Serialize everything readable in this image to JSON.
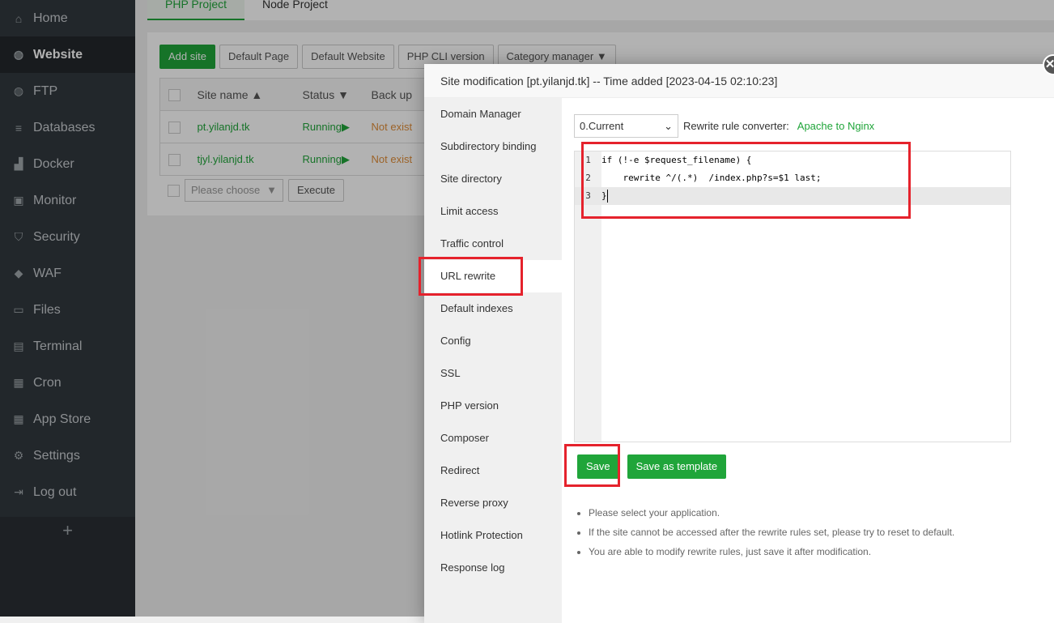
{
  "sidebar": {
    "items": [
      {
        "label": "Home",
        "icon": "home-icon"
      },
      {
        "label": "Website",
        "icon": "globe-icon",
        "active": true
      },
      {
        "label": "FTP",
        "icon": "ftp-icon"
      },
      {
        "label": "Databases",
        "icon": "database-icon"
      },
      {
        "label": "Docker",
        "icon": "docker-icon"
      },
      {
        "label": "Monitor",
        "icon": "monitor-icon"
      },
      {
        "label": "Security",
        "icon": "shield-icon"
      },
      {
        "label": "WAF",
        "icon": "waf-icon"
      },
      {
        "label": "Files",
        "icon": "folder-icon"
      },
      {
        "label": "Terminal",
        "icon": "terminal-icon"
      },
      {
        "label": "Cron",
        "icon": "calendar-icon"
      },
      {
        "label": "App Store",
        "icon": "grid-icon"
      },
      {
        "label": "Settings",
        "icon": "gear-icon"
      },
      {
        "label": "Log out",
        "icon": "logout-icon"
      }
    ],
    "add": "+"
  },
  "tabs": [
    "PHP Project",
    "Node Project"
  ],
  "toolbar": {
    "add_site": "Add site",
    "default_page": "Default Page",
    "default_website": "Default Website",
    "php_cli": "PHP CLI version",
    "category": "Category manager"
  },
  "table": {
    "headers": [
      "Site name",
      "Status",
      "Back up"
    ],
    "rows": [
      {
        "name": "pt.yilanjd.tk",
        "status": "Running",
        "backup": "Not exist"
      },
      {
        "name": "tjyl.yilanjd.tk",
        "status": "Running",
        "backup": "Not exist"
      }
    ]
  },
  "batch": {
    "placeholder": "Please choose",
    "execute": "Execute"
  },
  "modal": {
    "title": "Site modification [pt.yilanjd.tk] -- Time added [2023-04-15 02:10:23]",
    "menu": [
      "Domain Manager",
      "Subdirectory binding",
      "Site directory",
      "Limit access",
      "Traffic control",
      "URL rewrite",
      "Default indexes",
      "Config",
      "SSL",
      "PHP version",
      "Composer",
      "Redirect",
      "Reverse proxy",
      "Hotlink Protection",
      "Response log"
    ],
    "active_menu": "URL rewrite",
    "template_select": "0.Current",
    "converter_label": "Rewrite rule converter:",
    "converter_link": "Apache to Nginx",
    "code": [
      "if (!-e $request_filename) {",
      "    rewrite ^/(.*)  /index.php?s=$1 last;",
      "}"
    ],
    "save": "Save",
    "save_template": "Save as template",
    "tips": [
      "Please select your application.",
      "If the site cannot be accessed after the rewrite rules set, please try to reset to default.",
      "You are able to modify rewrite rules, just save it after modification."
    ]
  },
  "colors": {
    "accent": "#20a53a",
    "annotation": "#e5222c"
  }
}
